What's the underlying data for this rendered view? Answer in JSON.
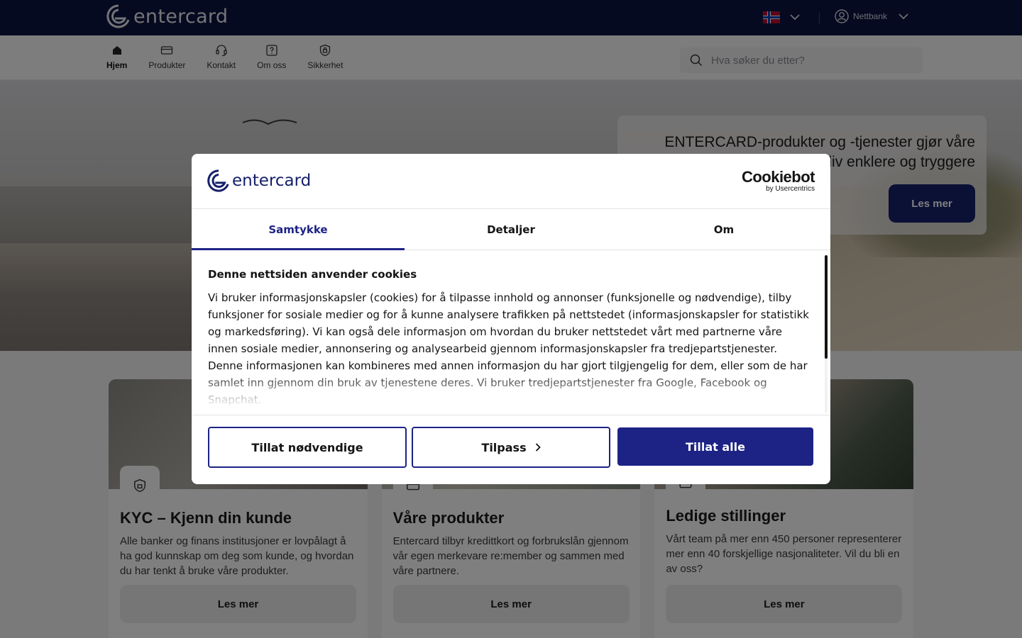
{
  "topbar": {
    "logo_text": "entercard",
    "netbank_label": "Nettbank",
    "language": "Norwegian flag"
  },
  "nav": {
    "items": [
      {
        "label": "Hjem",
        "icon": "home-icon",
        "active": true
      },
      {
        "label": "Produkter",
        "icon": "card-icon",
        "active": false
      },
      {
        "label": "Kontakt",
        "icon": "headset-icon",
        "active": false
      },
      {
        "label": "Om oss",
        "icon": "question-icon",
        "active": false
      },
      {
        "label": "Sikkerhet",
        "icon": "shield-icon",
        "active": false
      }
    ],
    "search_placeholder": "Hva søker du etter?"
  },
  "hero": {
    "headline": "ENTERCARD-produkter og -tjenester gjør våre kunders liv enklere og tryggere",
    "button": "Les mer"
  },
  "cards": [
    {
      "title": "KYC – Kjenn din kunde",
      "text": "Alle banker og finans institusjoner er lovpålagt å ha god kunnskap om deg som kunde, og hvordan du har tenkt å bruke våre produkter.",
      "button": "Les mer"
    },
    {
      "title": "Våre produkter",
      "text": "Entercard tilbyr kredittkort og forbrukslån gjennom vår egen merkevare re:member og sammen med våre partnere.",
      "button": "Les mer"
    },
    {
      "title": "Ledige stillinger",
      "text": "Vårt team på mer enn 450 personer representerer mer enn 40 forskjellige nasjonaliteter. Vil du bli en av oss?",
      "button": "Les mer"
    }
  ],
  "cookie_dialog": {
    "logo_text": "entercard",
    "provider_name": "Cookiebot",
    "provider_sub": "by Usercentrics",
    "tabs": [
      {
        "label": "Samtykke",
        "active": true
      },
      {
        "label": "Detaljer",
        "active": false
      },
      {
        "label": "Om",
        "active": false
      }
    ],
    "heading": "Denne nettsiden anvender cookies",
    "body": "Vi bruker informasjonskapsler (cookies) for å tilpasse innhold og annonser (funksjonelle og nødvendige), tilby funksjoner for sosiale medier og for å kunne analysere trafikken på nettstedet (informasjonskapsler for statistikk og markedsføring). Vi kan også dele informasjon om hvordan du bruker nettstedet vårt med partnerne våre innen sosiale medier, annonsering og analysearbeid gjennom informasjonskapsler fra tredjepartstjenester. Denne informasjonen kan kombineres med annen informasjon du har gjort tilgjengelig for dem, eller som de har samlet inn gjennom din bruk av tjenestene deres. Vi bruker tredjepartstjenester fra Google, Facebook og Snapchat.",
    "buttons": {
      "necessary": "Tillat nødvendige",
      "customize": "Tilpass",
      "allow_all": "Tillat alle"
    }
  },
  "colors": {
    "topbar": "#0b1440",
    "brand_blue": "#1d2385",
    "hero_button": "#16206b"
  }
}
